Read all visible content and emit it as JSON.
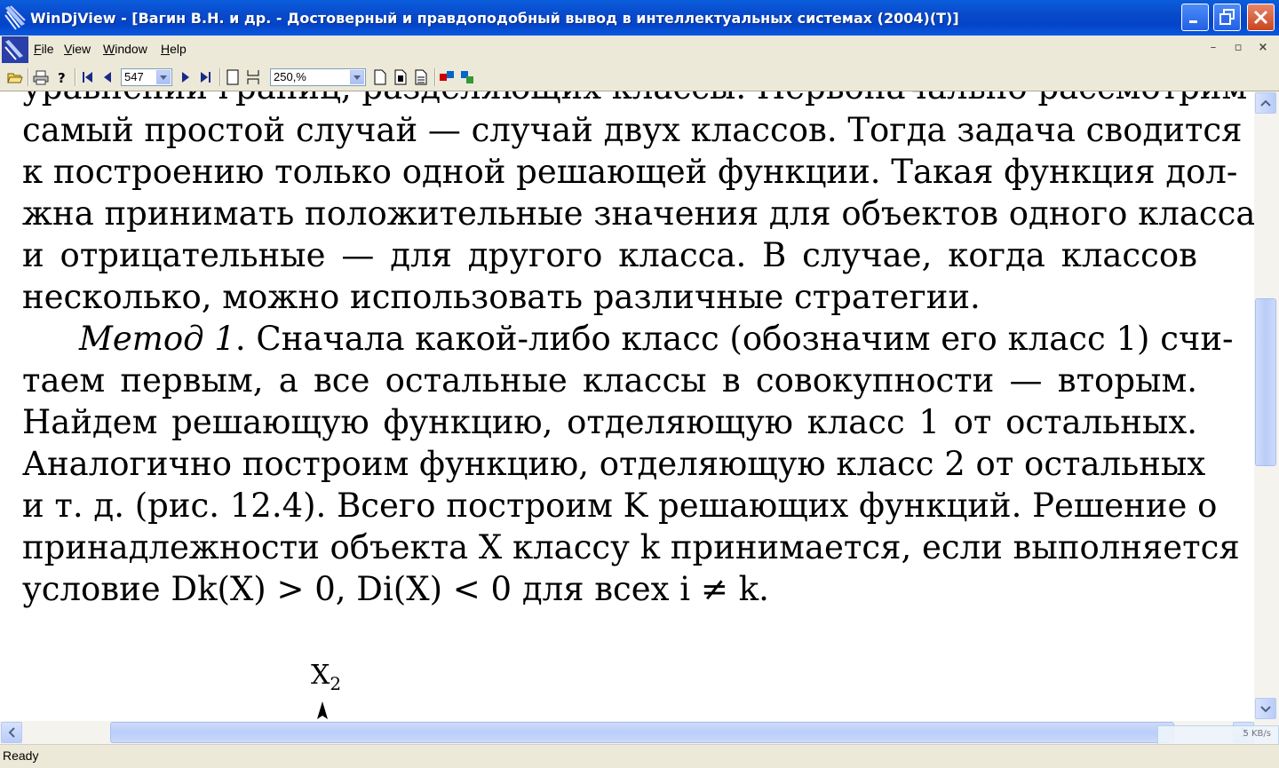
{
  "window": {
    "title": "WinDjView - [Вагин В.Н. и др. - Достоверный и правдоподобный вывод в интеллектуальных системах (2004)(T)]"
  },
  "menu": {
    "items": [
      "File",
      "View",
      "Window",
      "Help"
    ]
  },
  "toolbar": {
    "page_value": "547",
    "zoom_value": "250,%"
  },
  "document": {
    "top_cut_line": "уравнений границ, разделяющих классы. Первоначально рассмотрим",
    "para1_lines": [
      "самый простой случай — случай двух классов. Тогда задача сводится",
      "к построению только одной решающей функции. Такая функция дол-",
      "жна принимать положительные значения для объектов одного класса",
      "и отрицательные — для другого класса. В случае, когда классов",
      "несколько, можно использовать различные стратегии."
    ],
    "method_label": "Метод 1",
    "para2_first_rest": ". Сначала какой-либо класс (обозначим его класс 1) счи-",
    "para2_lines": [
      "таем первым, а все остальные классы в совокупности — вторым.",
      "Найдем решающую функцию, отделяющую класс 1 от остальных.",
      "Аналогично построим функцию, отделяющую класс 2 от остальных",
      "и т. д. (рис. 12.4). Всего построим K решающих функций. Решение о",
      "принадлежности объекта X классу k принимается, если выполняется",
      "условие Dk(X) > 0,  Di(X) < 0 для всех i ≠ k."
    ],
    "figure_axis_label": "X",
    "figure_axis_sub": "2"
  },
  "network_meter": "5 KB/s",
  "status": {
    "text": "Ready"
  },
  "colors": {
    "titlebar": "#0848c9",
    "chrome": "#ece9d8",
    "scroll_thumb": "#bacdf8"
  }
}
